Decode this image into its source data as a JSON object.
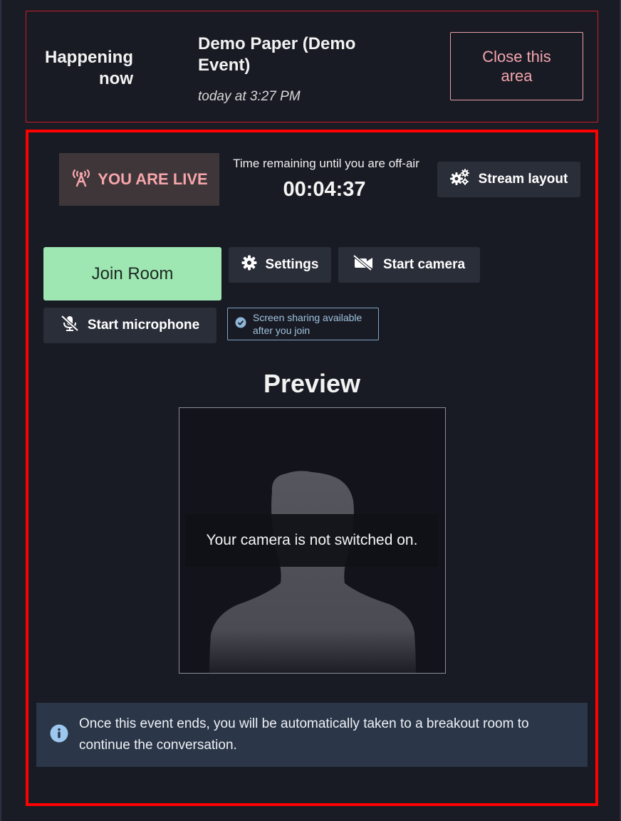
{
  "happening": {
    "label": "Happening now",
    "title": "Demo Paper (Demo Event)",
    "time": "today at 3:27 PM",
    "close_label": "Close this area"
  },
  "live": {
    "badge_label": "YOU ARE LIVE",
    "icon": "broadcast-tower-icon",
    "remaining_label": "Time remaining until you are off-air",
    "remaining_value": "00:04:37"
  },
  "controls": {
    "stream_layout_label": "Stream layout",
    "join_room_label": "Join Room",
    "settings_label": "Settings",
    "start_camera_label": "Start camera",
    "start_microphone_label": "Start microphone",
    "screen_sharing_note": "Screen sharing available after you join"
  },
  "preview": {
    "title": "Preview",
    "camera_message": "Your camera is not switched on."
  },
  "info": {
    "message": "Once this event ends, you will be automatically taken to a breakout room to continue the conversation."
  },
  "colors": {
    "background": "#191b24",
    "border_red": "#ff0000",
    "live_text": "#f6a6ab",
    "join_green": "#9ee6b2",
    "info_bg": "#2b3648"
  }
}
